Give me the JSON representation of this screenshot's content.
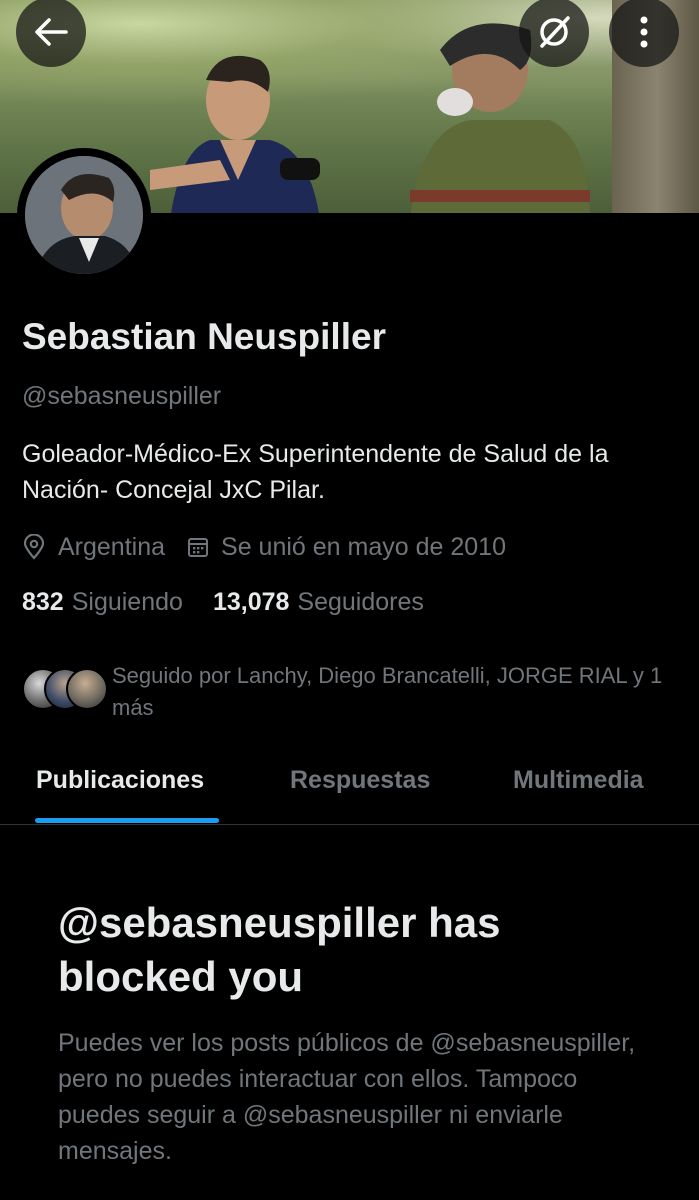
{
  "header": {
    "back_icon": "arrow-left-icon",
    "grok_icon": "slash-circle-icon",
    "more_icon": "more-vertical-icon"
  },
  "profile": {
    "name": "Sebastian Neuspiller",
    "handle": "@sebasneuspiller",
    "bio": "Goleador-Médico-Ex Superintendente de Salud de la Nación- Concejal JxC Pilar.",
    "location": "Argentina",
    "joined": "Se unió en mayo de 2010",
    "following_count": "832",
    "following_label": "Siguiendo",
    "followers_count": "13,078",
    "followers_label": "Seguidores",
    "followed_by": "Seguido por Lanchy, Diego Brancatelli, JORGE RIAL y 1 más"
  },
  "tabs": [
    {
      "label": "Publicaciones",
      "active": true
    },
    {
      "label": "Respuestas",
      "active": false
    },
    {
      "label": "Multimedia",
      "active": false
    }
  ],
  "blocked": {
    "title": "@sebasneuspiller has blocked you",
    "description": "Puedes ver los posts públicos de @sebasneuspiller, pero no puedes interactuar con ellos. Tampoco puedes seguir a @sebasneuspiller ni enviarle mensajes."
  },
  "colors": {
    "background": "#000000",
    "text": "#e7e9ea",
    "muted": "#71767b",
    "accent": "#1d9bf0"
  }
}
